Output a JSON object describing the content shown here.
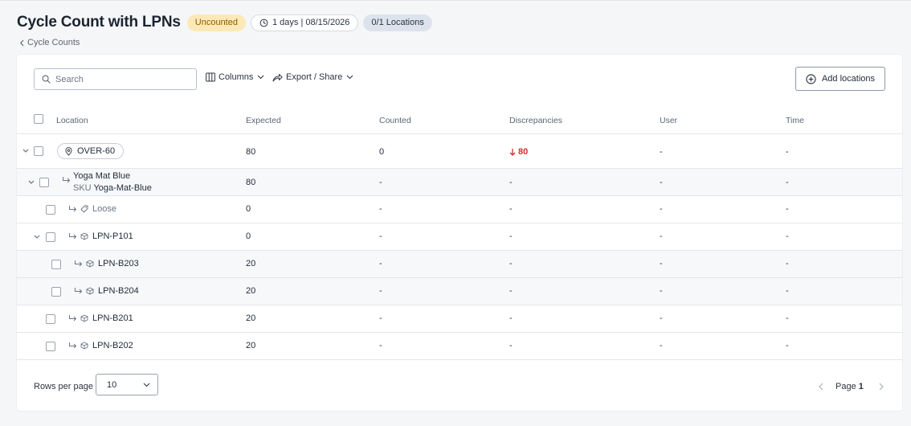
{
  "header": {
    "title": "Cycle Count with LPNs",
    "status": "Uncounted",
    "date_badge": "1 days | 08/15/2026",
    "locations_badge": "0/1 Locations",
    "breadcrumb": "Cycle Counts"
  },
  "toolbar": {
    "search_placeholder": "Search",
    "columns_label": "Columns",
    "export_label": "Export / Share",
    "add_locations_label": "Add locations"
  },
  "table": {
    "headers": {
      "location": "Location",
      "expected": "Expected",
      "counted": "Counted",
      "discrepancies": "Discrepancies",
      "user": "User",
      "time": "Time"
    },
    "rows": [
      {
        "kind": "location",
        "name": "OVER-60",
        "expected": "80",
        "counted": "0",
        "discrepancies": "80",
        "user": "-",
        "time": "-"
      },
      {
        "kind": "item",
        "name": "Yoga Mat Blue",
        "sku_label": "SKU",
        "sku": "Yoga-Mat-Blue",
        "expected": "80",
        "counted": "-",
        "discrepancies": "-",
        "user": "-",
        "time": "-"
      },
      {
        "kind": "loose",
        "name": "Loose",
        "expected": "0",
        "counted": "-",
        "discrepancies": "-",
        "user": "-",
        "time": "-"
      },
      {
        "kind": "lpn",
        "name": "LPN-P101",
        "expected": "0",
        "counted": "-",
        "discrepancies": "-",
        "user": "-",
        "time": "-"
      },
      {
        "kind": "lpn",
        "name": "LPN-B203",
        "expected": "20",
        "counted": "-",
        "discrepancies": "-",
        "user": "-",
        "time": "-"
      },
      {
        "kind": "lpn",
        "name": "LPN-B204",
        "expected": "20",
        "counted": "-",
        "discrepancies": "-",
        "user": "-",
        "time": "-"
      },
      {
        "kind": "lpn",
        "name": "LPN-B201",
        "expected": "20",
        "counted": "-",
        "discrepancies": "-",
        "user": "-",
        "time": "-"
      },
      {
        "kind": "lpn",
        "name": "LPN-B202",
        "expected": "20",
        "counted": "-",
        "discrepancies": "-",
        "user": "-",
        "time": "-"
      }
    ]
  },
  "footer": {
    "rows_per_page_label": "Rows per page",
    "rows_per_page_value": "10",
    "page_label": "Page",
    "page_number": "1"
  },
  "colors": {
    "status_badge_bg": "#fde9b8",
    "discrepancy_red": "#d12f2f",
    "locations_badge_bg": "#dde3ec"
  },
  "icons": [
    "clock-icon",
    "chevron-left-icon",
    "search-icon",
    "columns-icon",
    "chevron-down-icon",
    "share-icon",
    "plus-circle-icon",
    "location-pin-icon",
    "arrow-down-icon",
    "sub-item-arrow-icon",
    "tag-icon",
    "box-icon",
    "chevron-right-icon"
  ]
}
